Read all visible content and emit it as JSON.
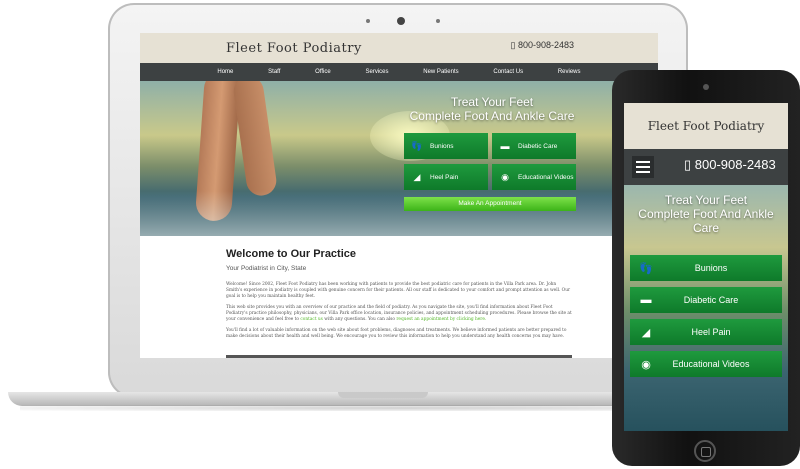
{
  "site": {
    "brand": "Fleet Foot Podiatry",
    "phone": "800-908-2483",
    "nav": [
      "Home",
      "Staff",
      "Office",
      "Services",
      "New Patients",
      "Contact Us",
      "Reviews"
    ],
    "hero_title_line1": "Treat Your Feet",
    "hero_title_line2": "Complete Foot And Ankle Care",
    "services": [
      {
        "label": "Bunions",
        "icon": "foot-icon"
      },
      {
        "label": "Diabetic Care",
        "icon": "shoe-icon"
      },
      {
        "label": "Heel Pain",
        "icon": "heel-icon"
      },
      {
        "label": "Educational Videos",
        "icon": "video-icon"
      }
    ],
    "appointment_button": "Make An Appointment",
    "welcome_title": "Welcome to Our Practice",
    "welcome_subtitle": "Your Podiatrist in City, State",
    "para1": "Welcome! Since 2002, Fleet Foot Podiatry has been working with patients to provide the best podiatric care for patients in the Villa Park area. Dr. John Smith's experience in podiatry is coupled with genuine concern for their patients. All our staff is dedicated to your comfort and prompt attention as well. Our goal is to help you maintain healthy feet.",
    "para2_a": "This web site provides you with an overview of our practice and the field of podiatry. As you navigate the site, you'll find information about Fleet Foot Podiatry's practice philosophy, physicians, our Villa Park office location, insurance policies, and appointment scheduling procedures. Please browse the site at your convenience and feel free to",
    "para2_link1": "contact us",
    "para2_b": "with any questions. You can also",
    "para2_link2": "request an appointment by clicking here.",
    "para3": "You'll find a lot of valuable information on the web site about foot problems, diagnoses and treatments. We believe informed patients are better prepared to make decisions about their health and well being. We encourage you to review this information to help you understand any health concerns you may have."
  },
  "colors": {
    "header_bg": "#e6e1d4",
    "nav_bg": "#3d4142",
    "service_green": "#1f9a3e",
    "appointment_green": "#5acb2a",
    "link_green": "#55b82a"
  }
}
